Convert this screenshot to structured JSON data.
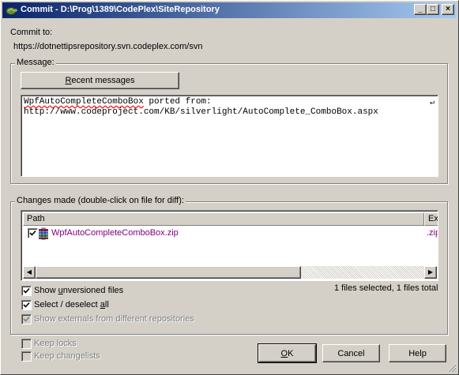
{
  "window": {
    "title": "Commit - D:\\Prog\\1389\\CodePlex\\SiteRepository",
    "minimize": "_",
    "maximize": "□",
    "close": "×"
  },
  "commit": {
    "label": "Commit to:",
    "url": "https://dotnettipsrepository.svn.codeplex.com/svn"
  },
  "message": {
    "group_label": "Message:",
    "recent_button": "Recent messages",
    "line1_word": "WpfAutoCompleteComboBox",
    "line1_rest": " ported from:",
    "line2": "http://www.codeproject.com/KB/silverlight/AutoComplete_ComboBox.aspx"
  },
  "changes": {
    "group_label": "Changes made (double-click on file for diff):",
    "columns": [
      "Path",
      "Ex"
    ],
    "rows": [
      {
        "checked": true,
        "path": "WpfAutoCompleteComboBox.zip",
        "ext": ".zip"
      }
    ],
    "status": "1 files selected, 1 files total"
  },
  "options": {
    "show_unversioned": {
      "label": "Show unversioned files",
      "checked": true
    },
    "select_all": {
      "label": "Select / deselect all",
      "checked": true
    },
    "show_externals": {
      "label": "Show externals from different repositories",
      "checked": true,
      "enabled": false
    },
    "keep_locks": {
      "label": "Keep locks",
      "checked": false,
      "enabled": false
    },
    "keep_changelists": {
      "label": "Keep changelists",
      "checked": false,
      "enabled": false
    }
  },
  "buttons": {
    "ok": "OK",
    "cancel": "Cancel",
    "help": "Help"
  },
  "colors": {
    "title_gradient_start": "#0a246a",
    "title_gradient_end": "#a6caf0",
    "dialog_face": "#d4d0c8",
    "file_link": "#800080"
  }
}
